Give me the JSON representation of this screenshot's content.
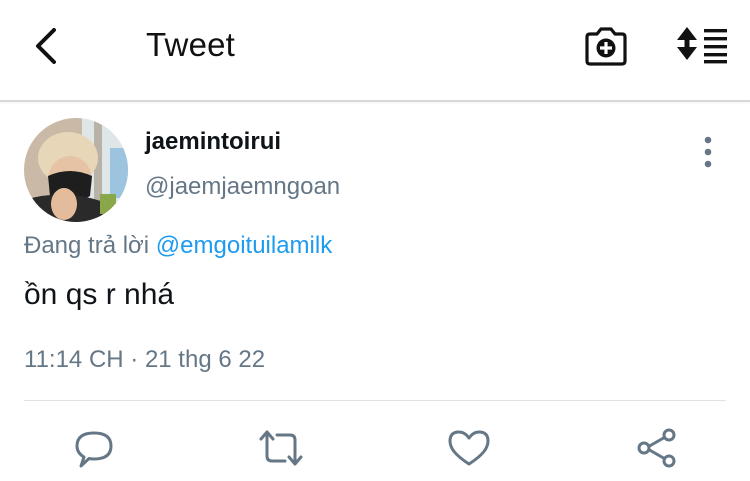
{
  "header": {
    "title": "Tweet",
    "back_icon": "chevron-left-icon",
    "camera_icon": "camera-plus-icon",
    "sort_icon": "sort-list-icon"
  },
  "tweet": {
    "author": {
      "display_name": "jaemintoirui",
      "handle": "@jaemjaemngoan"
    },
    "reply_prefix": "Đang trả lời",
    "reply_to": "@emgoituilamilk",
    "text": "ồn qs r nhá",
    "timestamp": "11:14 CH · 21 thg 6 22"
  },
  "actions": [
    {
      "name": "reply",
      "icon": "comment-icon"
    },
    {
      "name": "retweet",
      "icon": "retweet-icon"
    },
    {
      "name": "like",
      "icon": "heart-icon"
    },
    {
      "name": "share",
      "icon": "share-icon"
    }
  ],
  "colors": {
    "link": "#1d9bf0",
    "secondary_text": "#657786",
    "primary_text": "#0f1419",
    "icon": "#657786"
  }
}
